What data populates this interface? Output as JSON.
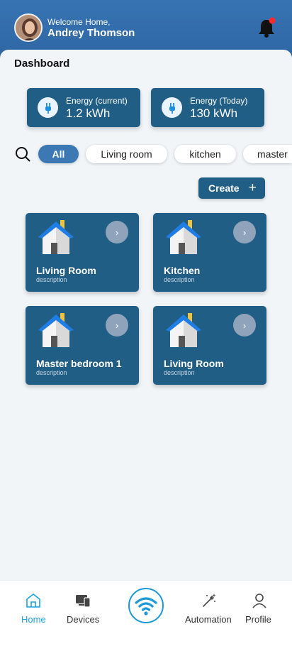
{
  "header": {
    "welcome": "Welcome Home,",
    "user_name": "Andrey Thomson"
  },
  "page": {
    "title": "Dashboard"
  },
  "energy": [
    {
      "label": "Energy (current)",
      "value": "1.2 kWh"
    },
    {
      "label": "Energy (Today)",
      "value": "130 kWh"
    }
  ],
  "filters": [
    {
      "label": "All",
      "selected": true
    },
    {
      "label": "Living room",
      "selected": false
    },
    {
      "label": "kitchen",
      "selected": false
    },
    {
      "label": "master",
      "selected": false
    }
  ],
  "create_label": "Create",
  "rooms": [
    {
      "name": "Living Room",
      "description": "description"
    },
    {
      "name": "Kitchen",
      "description": "description"
    },
    {
      "name": "Master bedroom 1",
      "description": "description"
    },
    {
      "name": "Living Room",
      "description": "description"
    }
  ],
  "nav": {
    "home": "Home",
    "devices": "Devices",
    "automation": "Automation",
    "profile": "Profile"
  },
  "colors": {
    "header": "#3773b3",
    "card": "#215e85",
    "accent": "#18a2e8",
    "notification_dot": "#ff2a2a"
  }
}
